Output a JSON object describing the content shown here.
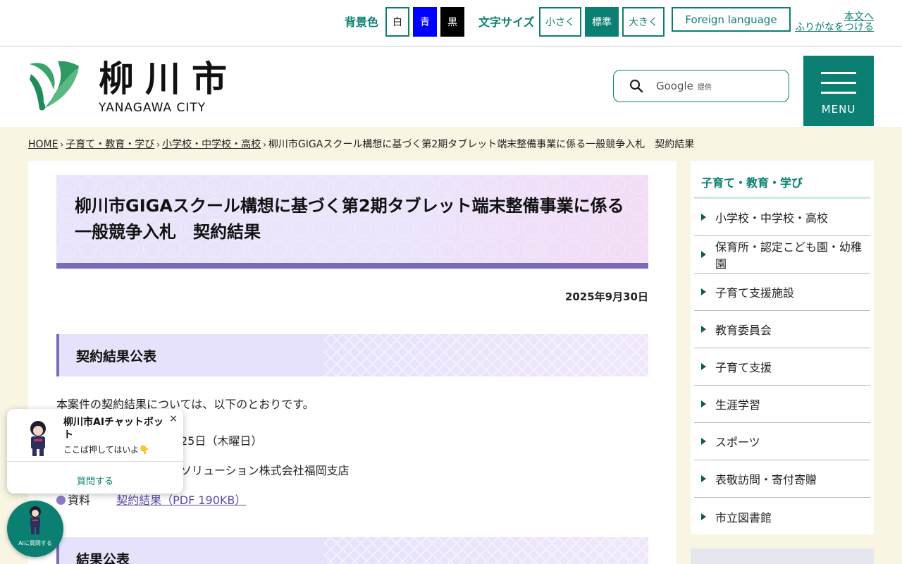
{
  "utility": {
    "bg_label": "背景色",
    "bg_white": "白",
    "bg_blue": "青",
    "bg_black": "黒",
    "font_label": "文字サイズ",
    "font_small": "小さく",
    "font_standard": "標準",
    "font_large": "大きく",
    "foreign": "Foreign language",
    "skip": "本文へ",
    "furigana": "ふりがなをつける"
  },
  "header": {
    "logo_kanji": "柳川市",
    "logo_roman": "YANAGAWA CITY",
    "search_brand": "Google",
    "search_provided": "提供",
    "menu_label": "MENU"
  },
  "breadcrumb": [
    "HOME",
    "子育て・教育・学び",
    "小学校・中学校・高校",
    "柳川市GIGAスクール構想に基づく第2期タブレット端末整備事業に係る一般競争入札　契約結果"
  ],
  "article": {
    "title_line1": "柳川市GIGAスクール構想に基づく第2期タブレット端末整備事業に係る",
    "title_line2": "一般競争入札　契約結果",
    "date": "2025年9月30日",
    "section1": "契約結果公表",
    "intro": "本案件の契約結果については、以下のとおりです。",
    "contract_date_partial": "25日（木曜日）",
    "contractor_partial": "ソリューション株式会社福岡支店",
    "material_label": "資料",
    "material_link": "契約結果（PDF 190KB）",
    "section2": "結果公表"
  },
  "sidebar": {
    "title": "子育て・教育・学び",
    "items": [
      "小学校・中学校・高校",
      "保育所・認定こども園・幼稚園",
      "子育て支援施設",
      "教育委員会",
      "子育て支援",
      "生涯学習",
      "スポーツ",
      "表敬訪問・寄付寄贈",
      "市立図書館"
    ]
  },
  "chat": {
    "title": "柳川市AIチャットボット",
    "subtitle": "ここば押してはいよ👇",
    "close": "×",
    "ask": "質問する",
    "fab_label": "AIに質問する"
  },
  "colors": {
    "brand": "#0b7f72",
    "accent_purple": "#7b6bb6",
    "page_bg": "#f8f5e3"
  }
}
